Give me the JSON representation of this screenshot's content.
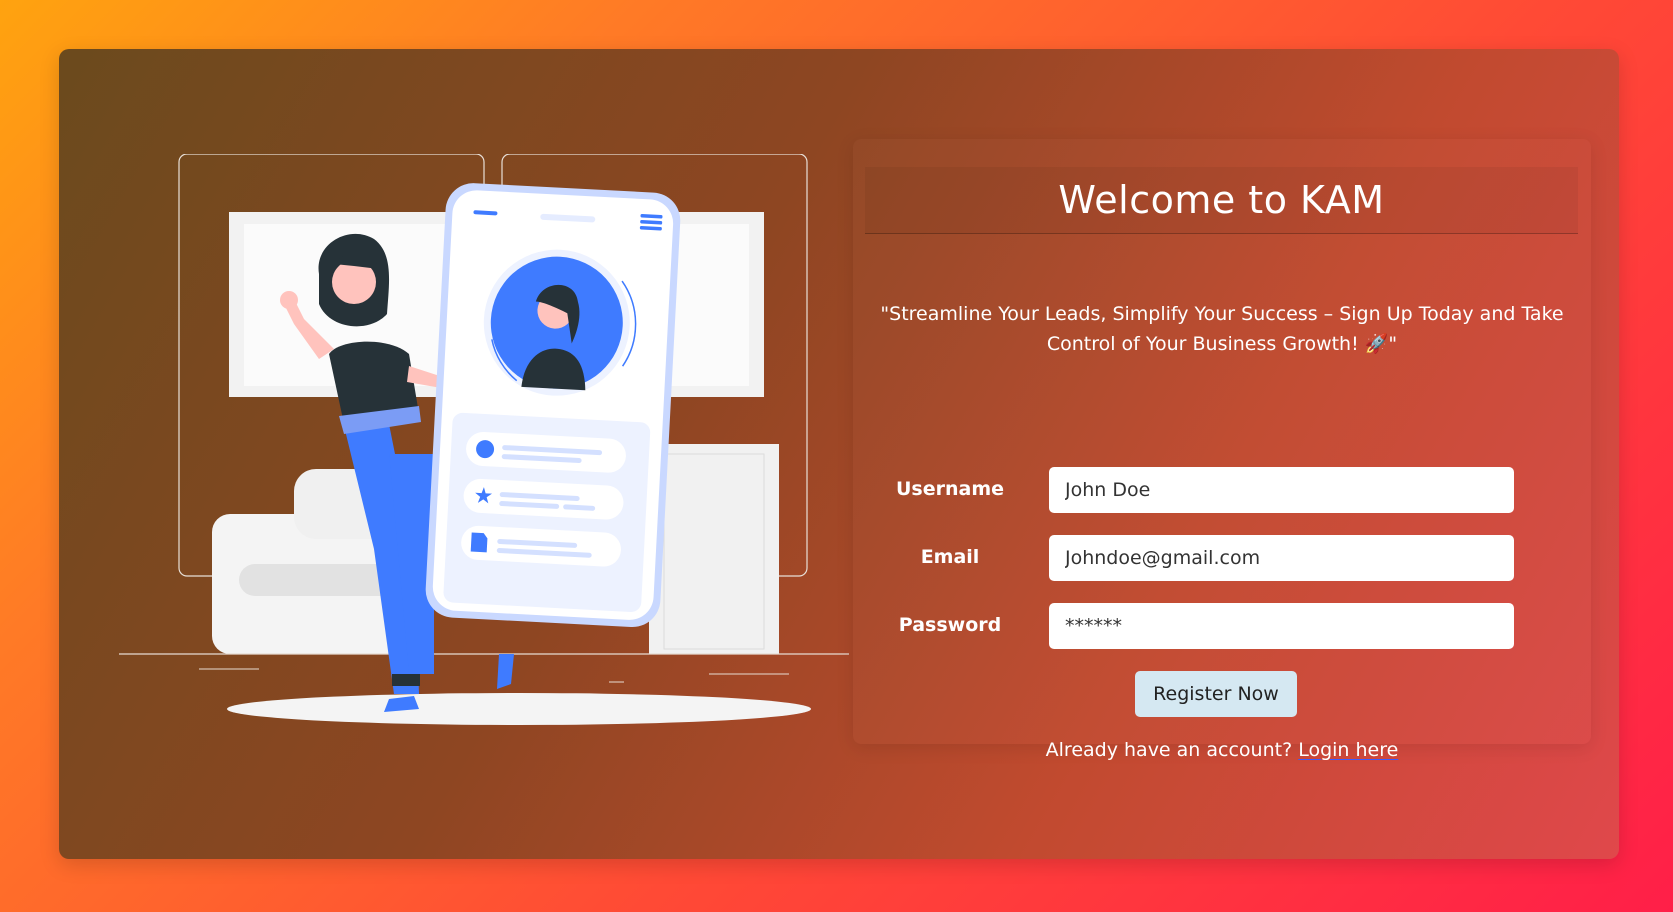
{
  "form": {
    "title": "Welcome to KAM",
    "tagline": "\"Streamline Your Leads, Simplify Your Success – Sign Up Today and Take Control of Your Business Growth! 🚀\"",
    "fields": [
      {
        "label": "Username",
        "value": "John Doe"
      },
      {
        "label": "Email",
        "value": "Johndoe@gmail.com"
      },
      {
        "label": "Password",
        "value": "******"
      }
    ],
    "register_label": "Register Now",
    "login_prompt": "Already have an account?",
    "login_link": "Login here"
  },
  "colors": {
    "accent_blue": "#3f7bff",
    "button_bg": "#d5e8f2"
  }
}
